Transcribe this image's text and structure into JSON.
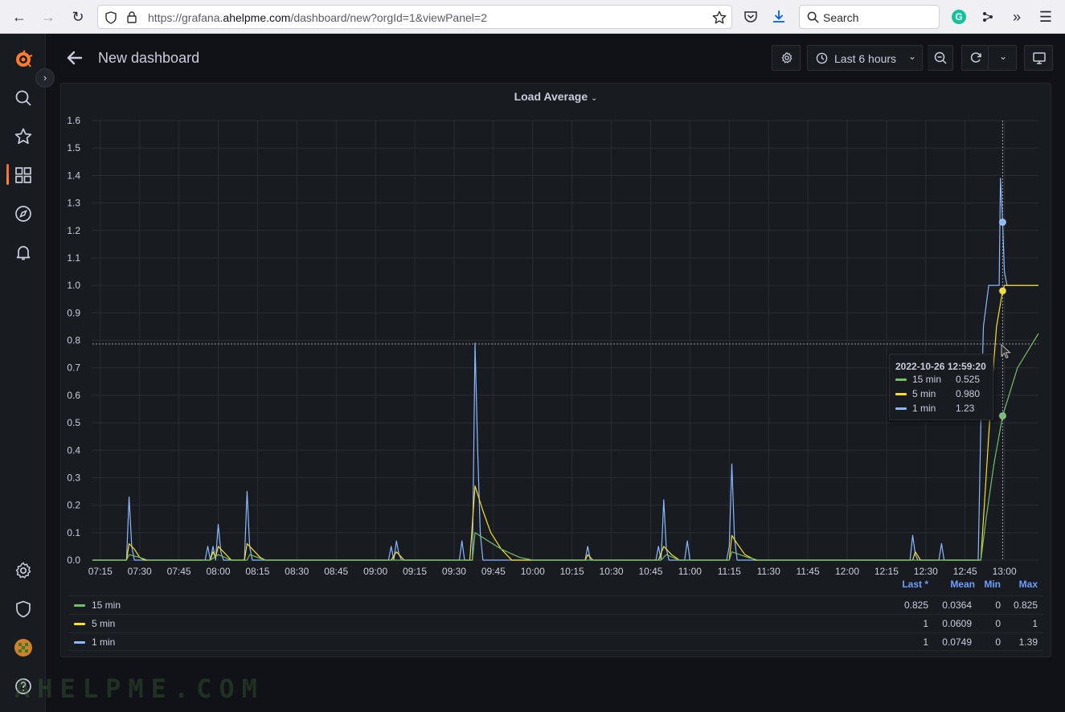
{
  "browser": {
    "url_prefix": "https://grafana.",
    "url_domain": "ahelpme.com",
    "url_suffix": "/dashboard/new?orgId=1&viewPanel=2",
    "search_placeholder": "Search"
  },
  "topnav": {
    "title": "New dashboard",
    "time_range_label": "Last 6 hours"
  },
  "panel": {
    "title": "Load Average"
  },
  "tooltip": {
    "time": "2022-10-26 12:59:20",
    "rows": [
      {
        "name": "15 min",
        "value": "0.525"
      },
      {
        "name": "5 min",
        "value": "0.980"
      },
      {
        "name": "1 min",
        "value": "1.23"
      }
    ]
  },
  "legend": {
    "headers": {
      "last": "Last *",
      "mean": "Mean",
      "min": "Min",
      "max": "Max"
    },
    "rows": [
      {
        "name": "15 min",
        "last": "0.825",
        "mean": "0.0364",
        "min": "0",
        "max": "0.825"
      },
      {
        "name": "5 min",
        "last": "1",
        "mean": "0.0609",
        "min": "0",
        "max": "1"
      },
      {
        "name": "1 min",
        "last": "1",
        "mean": "0.0749",
        "min": "0",
        "max": "1.39"
      }
    ]
  },
  "colors": {
    "series_15min": "#73bf69",
    "series_5min": "#fade2a",
    "series_1min": "#8ab8ff",
    "legend_header": "#6e9fff",
    "grafana_orange": "#ff7b30"
  },
  "icons": {
    "sidebar": [
      "grafana-logo-icon",
      "search-icon",
      "star-icon",
      "dashboards-icon",
      "explore-icon",
      "alerting-icon",
      "gear-icon",
      "shield-icon",
      "avatar",
      "help-icon"
    ]
  },
  "watermark": "AHELPME.COM",
  "chart_data": {
    "type": "line",
    "x_ticks": [
      "07:15",
      "07:30",
      "07:45",
      "08:00",
      "08:15",
      "08:30",
      "08:45",
      "09:00",
      "09:15",
      "09:30",
      "09:45",
      "10:00",
      "10:15",
      "10:30",
      "10:45",
      "11:00",
      "11:15",
      "11:30",
      "11:45",
      "12:00",
      "12:15",
      "12:30",
      "12:45",
      "13:00"
    ],
    "y_ticks": [
      "0.0",
      "0.1",
      "0.2",
      "0.3",
      "0.4",
      "0.5",
      "0.6",
      "0.7",
      "0.8",
      "0.9",
      "1.0",
      "1.1",
      "1.2",
      "1.3",
      "1.4",
      "1.5",
      "1.6"
    ],
    "ylim": [
      0,
      1.6
    ],
    "xlim": [
      "07:12",
      "13:13"
    ],
    "grid": true,
    "series": [
      {
        "name": "1 min",
        "points": [
          [
            "07:12",
            0
          ],
          [
            "07:25",
            0
          ],
          [
            "07:26",
            0.23
          ],
          [
            "07:27",
            0.05
          ],
          [
            "07:28",
            0
          ],
          [
            "07:55",
            0
          ],
          [
            "07:56",
            0.05
          ],
          [
            "07:57",
            0
          ],
          [
            "07:58",
            0.05
          ],
          [
            "07:59",
            0
          ],
          [
            "08:00",
            0.13
          ],
          [
            "08:01",
            0.03
          ],
          [
            "08:02",
            0
          ],
          [
            "08:10",
            0
          ],
          [
            "08:11",
            0.25
          ],
          [
            "08:12",
            0.05
          ],
          [
            "08:13",
            0
          ],
          [
            "09:05",
            0
          ],
          [
            "09:06",
            0.05
          ],
          [
            "09:07",
            0
          ],
          [
            "09:08",
            0.07
          ],
          [
            "09:09",
            0.02
          ],
          [
            "09:10",
            0
          ],
          [
            "09:32",
            0
          ],
          [
            "09:33",
            0.07
          ],
          [
            "09:34",
            0
          ],
          [
            "09:37",
            0
          ],
          [
            "09:38",
            0.79
          ],
          [
            "09:39",
            0.4
          ],
          [
            "09:40",
            0.1
          ],
          [
            "09:41",
            0
          ],
          [
            "10:20",
            0
          ],
          [
            "10:21",
            0.05
          ],
          [
            "10:22",
            0
          ],
          [
            "10:47",
            0
          ],
          [
            "10:48",
            0.05
          ],
          [
            "10:49",
            0
          ],
          [
            "10:50",
            0.22
          ],
          [
            "10:51",
            0.04
          ],
          [
            "10:52",
            0
          ],
          [
            "10:58",
            0
          ],
          [
            "10:59",
            0.07
          ],
          [
            "11:00",
            0
          ],
          [
            "11:14",
            0
          ],
          [
            "11:15",
            0.05
          ],
          [
            "11:16",
            0.35
          ],
          [
            "11:17",
            0.08
          ],
          [
            "11:18",
            0
          ],
          [
            "12:24",
            0
          ],
          [
            "12:25",
            0.09
          ],
          [
            "12:26",
            0.02
          ],
          [
            "12:27",
            0
          ],
          [
            "12:35",
            0
          ],
          [
            "12:36",
            0.06
          ],
          [
            "12:37",
            0
          ],
          [
            "12:50",
            0
          ],
          [
            "12:51",
            0.5
          ],
          [
            "12:52",
            0.85
          ],
          [
            "12:54",
            1.0
          ],
          [
            "12:58",
            1.0
          ],
          [
            "12:58:30",
            1.39
          ],
          [
            "12:59:20",
            1.23
          ],
          [
            "13:00",
            1.05
          ],
          [
            "13:01",
            1.0
          ],
          [
            "13:13",
            1.0
          ]
        ]
      },
      {
        "name": "5 min",
        "points": [
          [
            "07:12",
            0
          ],
          [
            "07:25",
            0
          ],
          [
            "07:26",
            0.06
          ],
          [
            "07:28",
            0.04
          ],
          [
            "07:30",
            0.01
          ],
          [
            "07:32",
            0
          ],
          [
            "07:57",
            0
          ],
          [
            "07:58",
            0.03
          ],
          [
            "07:59",
            0.01
          ],
          [
            "08:00",
            0.05
          ],
          [
            "08:02",
            0.03
          ],
          [
            "08:05",
            0
          ],
          [
            "08:10",
            0
          ],
          [
            "08:11",
            0.06
          ],
          [
            "08:13",
            0.04
          ],
          [
            "08:16",
            0.01
          ],
          [
            "08:18",
            0
          ],
          [
            "09:06",
            0
          ],
          [
            "09:08",
            0.03
          ],
          [
            "09:11",
            0
          ],
          [
            "09:36",
            0
          ],
          [
            "09:38",
            0.27
          ],
          [
            "09:41",
            0.18
          ],
          [
            "09:44",
            0.1
          ],
          [
            "09:48",
            0.04
          ],
          [
            "09:52",
            0
          ],
          [
            "10:20",
            0
          ],
          [
            "10:21",
            0.02
          ],
          [
            "10:23",
            0
          ],
          [
            "10:48",
            0
          ],
          [
            "10:50",
            0.05
          ],
          [
            "10:53",
            0.02
          ],
          [
            "10:56",
            0
          ],
          [
            "11:15",
            0
          ],
          [
            "11:16",
            0.09
          ],
          [
            "11:18",
            0.06
          ],
          [
            "11:21",
            0.02
          ],
          [
            "11:25",
            0
          ],
          [
            "12:25",
            0
          ],
          [
            "12:26",
            0.03
          ],
          [
            "12:28",
            0
          ],
          [
            "12:51",
            0
          ],
          [
            "12:53",
            0.3
          ],
          [
            "12:55",
            0.6
          ],
          [
            "12:57",
            0.85
          ],
          [
            "12:59:20",
            0.98
          ],
          [
            "13:00",
            1.0
          ],
          [
            "13:13",
            1.0
          ]
        ]
      },
      {
        "name": "15 min",
        "points": [
          [
            "07:12",
            0
          ],
          [
            "07:25",
            0
          ],
          [
            "07:26",
            0.02
          ],
          [
            "07:30",
            0.01
          ],
          [
            "07:33",
            0
          ],
          [
            "07:57",
            0
          ],
          [
            "08:00",
            0.02
          ],
          [
            "08:05",
            0
          ],
          [
            "08:11",
            0
          ],
          [
            "08:12",
            0.02
          ],
          [
            "08:18",
            0
          ],
          [
            "09:37",
            0
          ],
          [
            "09:38",
            0.1
          ],
          [
            "09:43",
            0.07
          ],
          [
            "09:48",
            0.04
          ],
          [
            "09:55",
            0.01
          ],
          [
            "10:00",
            0
          ],
          [
            "10:49",
            0
          ],
          [
            "10:51",
            0.02
          ],
          [
            "10:56",
            0
          ],
          [
            "11:15",
            0
          ],
          [
            "11:16",
            0.03
          ],
          [
            "11:22",
            0.01
          ],
          [
            "11:26",
            0
          ],
          [
            "12:51",
            0
          ],
          [
            "12:53",
            0.15
          ],
          [
            "12:56",
            0.35
          ],
          [
            "12:59:20",
            0.525
          ],
          [
            "13:05",
            0.7
          ],
          [
            "13:13",
            0.825
          ]
        ]
      }
    ]
  }
}
